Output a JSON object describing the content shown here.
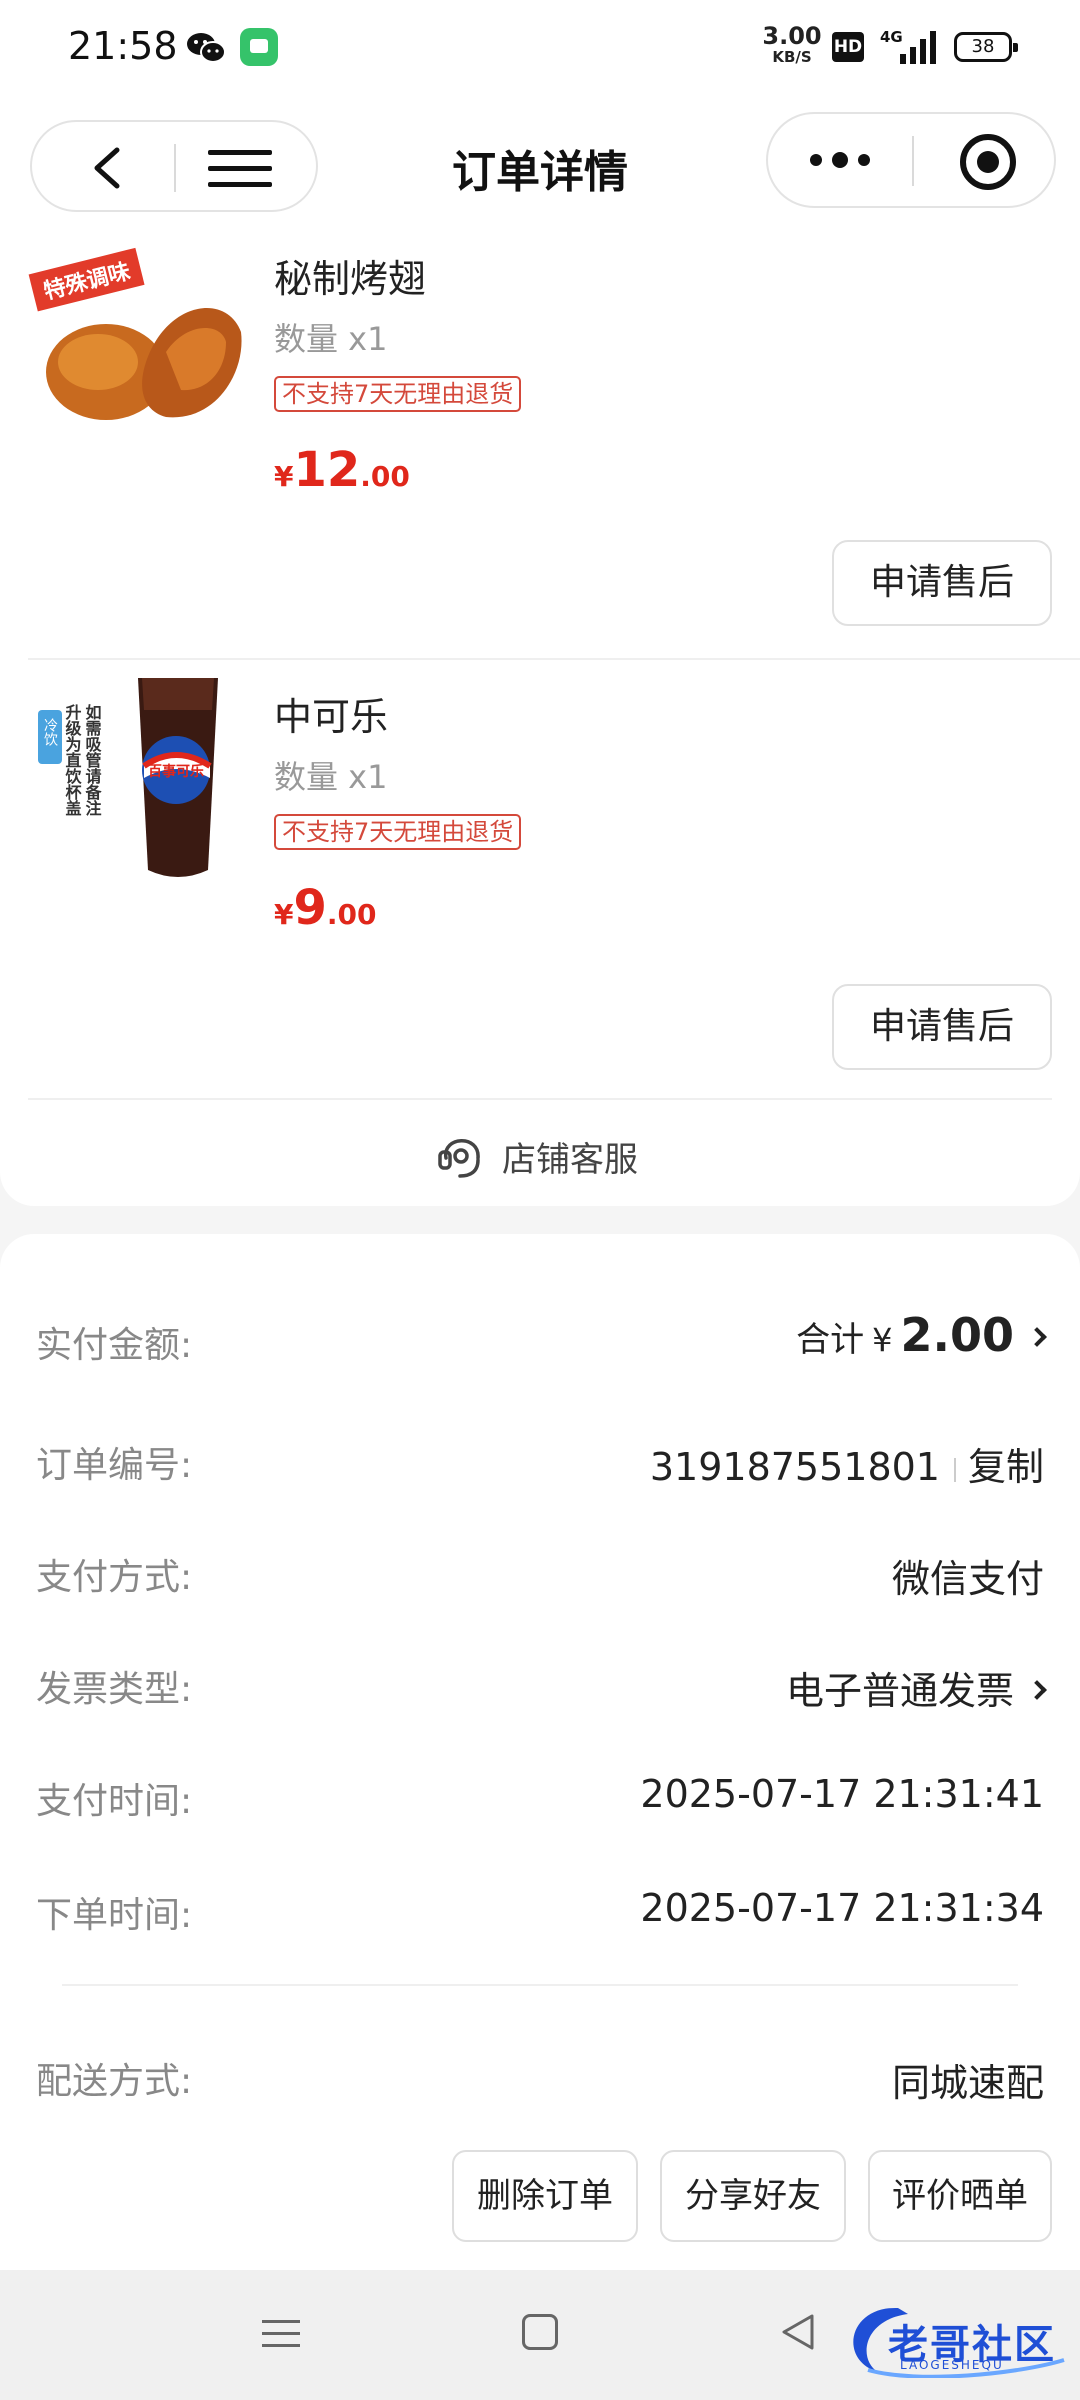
{
  "status_bar": {
    "time": "21:58",
    "network_speed": "3.00",
    "network_speed_unit": "KB/S",
    "hd_badge": "HD",
    "signal_label": "4G",
    "battery": "38"
  },
  "header": {
    "title": "订单详情"
  },
  "products": [
    {
      "name": "秘制烤翅",
      "quantity": "数量 x1",
      "tag": "不支持7天无理由退货",
      "price_currency": "¥",
      "price_int": "12",
      "price_dec": ".00",
      "after_sale_label": "申请售后",
      "image_badge": "特殊调味"
    },
    {
      "name": "中可乐",
      "quantity": "数量 x1",
      "tag": "不支持7天无理由退货",
      "price_currency": "¥",
      "price_int": "9",
      "price_dec": ".00",
      "after_sale_label": "申请售后",
      "image_badge": "冷饮",
      "image_text_1": "如需吸管请备注",
      "image_text_2": "升级为直饮杯盖",
      "image_brand": "百事可乐"
    }
  ],
  "store_service": {
    "label": "店铺客服"
  },
  "order_info": {
    "paid": {
      "label": "实付金额:",
      "prefix": "合计",
      "currency": "¥",
      "amount": "2.00"
    },
    "order_no": {
      "label": "订单编号:",
      "value": "319187551801",
      "copy_label": "复制"
    },
    "pay_method": {
      "label": "支付方式:",
      "value": "微信支付"
    },
    "invoice": {
      "label": "发票类型:",
      "value": "电子普通发票"
    },
    "pay_time": {
      "label": "支付时间:",
      "value": "2025-07-17 21:31:41"
    },
    "order_time": {
      "label": "下单时间:",
      "value": "2025-07-17 21:31:34"
    },
    "delivery": {
      "label": "配送方式:",
      "value": "同城速配"
    }
  },
  "actions": {
    "delete": "删除订单",
    "share": "分享好友",
    "review": "评价晒单"
  },
  "watermark": {
    "text": "老哥社区",
    "sub": "LAOGESHEQU"
  },
  "colors": {
    "price_red": "#e0271b",
    "tag_red": "#d4493b",
    "page_bg": "#f5f5f5",
    "watermark_blue": "#1f4fd6"
  }
}
